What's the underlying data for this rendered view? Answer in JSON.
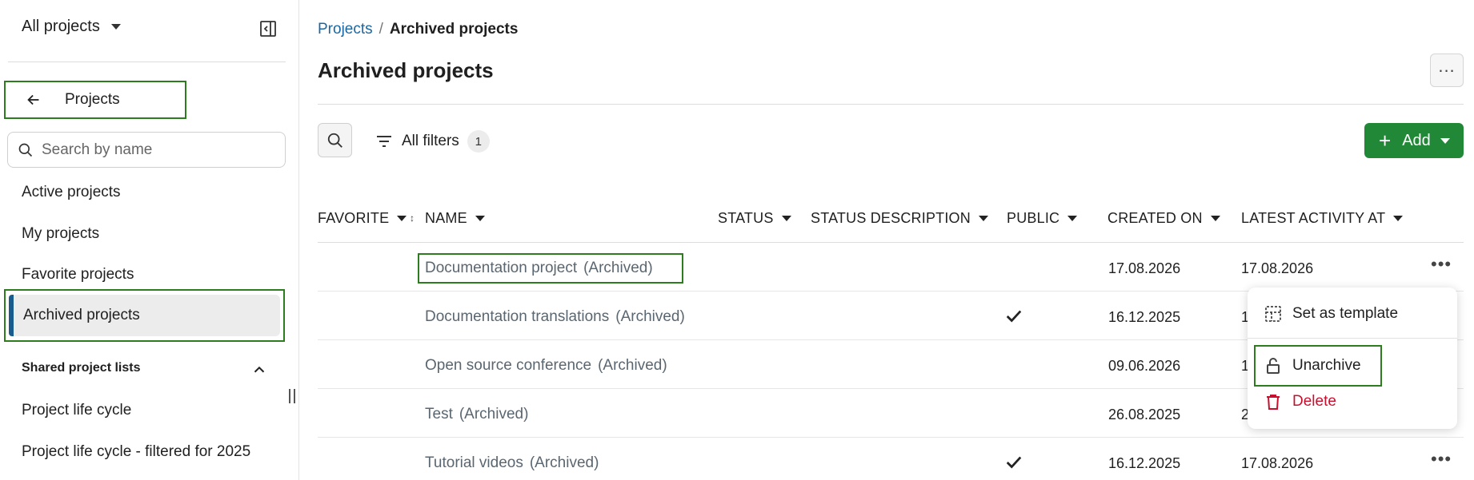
{
  "sidebar": {
    "project_switcher": "All projects",
    "back_label": "Projects",
    "search_placeholder": "Search by name",
    "items": [
      {
        "label": "Active projects"
      },
      {
        "label": "My projects"
      },
      {
        "label": "Favorite projects"
      },
      {
        "label": "Archived projects"
      }
    ],
    "shared_heading": "Shared project lists",
    "shared_items": [
      {
        "label": "Project life cycle"
      },
      {
        "label": "Project life cycle - filtered for 2025"
      }
    ]
  },
  "breadcrumb": {
    "parent": "Projects",
    "separator": "/",
    "current": "Archived projects"
  },
  "page": {
    "title": "Archived projects",
    "more_label": "..."
  },
  "toolbar": {
    "filters_label": "All filters",
    "filters_count": "1",
    "add_label": "Add"
  },
  "table": {
    "columns": [
      {
        "label": "FAVORITE"
      },
      {
        "label": "NAME"
      },
      {
        "label": "STATUS"
      },
      {
        "label": "STATUS DESCRIPTION"
      },
      {
        "label": "PUBLIC"
      },
      {
        "label": "CREATED ON"
      },
      {
        "label": "LATEST ACTIVITY AT"
      }
    ],
    "sort_indicator": "↕",
    "rows": [
      {
        "name": "Documentation project",
        "archived": "(Archived)",
        "public": false,
        "created_on": "17.08.2026",
        "latest_activity": "17.08.2026"
      },
      {
        "name": "Documentation translations",
        "archived": "(Archived)",
        "public": true,
        "created_on": "16.12.2025",
        "latest_activity": "1"
      },
      {
        "name": "Open source conference",
        "archived": "(Archived)",
        "public": false,
        "created_on": "09.06.2026",
        "latest_activity": "1"
      },
      {
        "name": "Test",
        "archived": "(Archived)",
        "public": false,
        "created_on": "26.08.2025",
        "latest_activity": "2"
      },
      {
        "name": "Tutorial videos",
        "archived": "(Archived)",
        "public": true,
        "created_on": "16.12.2025",
        "latest_activity": "17.08.2026"
      }
    ]
  },
  "context_menu": {
    "set_template": "Set as template",
    "unarchive": "Unarchive",
    "delete": "Delete"
  },
  "colors": {
    "accent_green": "#218838",
    "highlight_border": "#2d7d1e",
    "link_blue": "#1a67a3",
    "delete_red": "#c8102e",
    "active_bar": "#1a5b8e"
  },
  "icons": [
    "chevron-down-icon",
    "sidebar-collapse-icon",
    "arrow-left-icon",
    "search-icon",
    "chevron-up-icon",
    "filter-icon",
    "plus-icon",
    "more-icon",
    "checkmark-icon",
    "template-icon",
    "unlock-icon",
    "trash-icon"
  ]
}
